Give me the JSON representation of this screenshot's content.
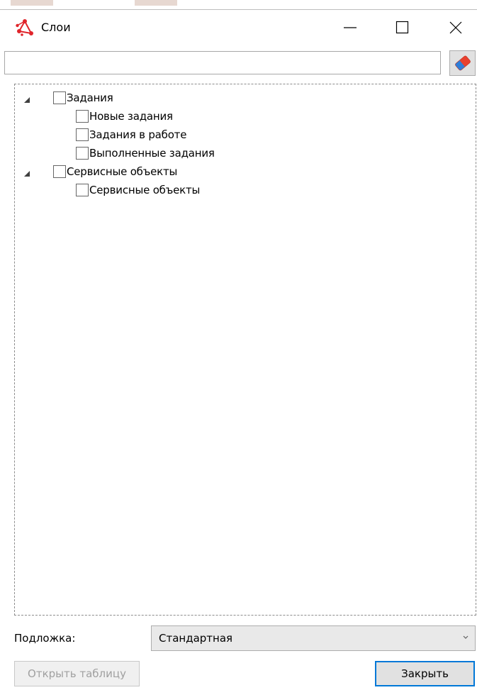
{
  "window": {
    "title": "Слои",
    "controls": [
      "minimize-icon",
      "maximize-icon",
      "close-icon"
    ]
  },
  "search": {
    "value": "",
    "placeholder": ""
  },
  "clear_button": {
    "icon": "eraser-icon"
  },
  "tree": [
    {
      "label": "Задания",
      "expanded": true,
      "checked": false,
      "children": [
        {
          "label": "Новые задания",
          "checked": false
        },
        {
          "label": "Задания в работе",
          "checked": false
        },
        {
          "label": "Выполненные задания",
          "checked": false
        }
      ]
    },
    {
      "label": "Сервисные объекты",
      "expanded": true,
      "checked": false,
      "children": [
        {
          "label": "Сервисные объекты",
          "checked": false
        }
      ]
    }
  ],
  "background": {
    "label": "Подложка:",
    "selected": "Стандартная"
  },
  "buttons": {
    "open_table": "Открыть таблицу",
    "close": "Закрыть"
  },
  "colors": {
    "accent": "#0078d7",
    "app_icon": "#e0252b",
    "eraser_red": "#e8402e",
    "eraser_blue": "#2f7ed8"
  }
}
